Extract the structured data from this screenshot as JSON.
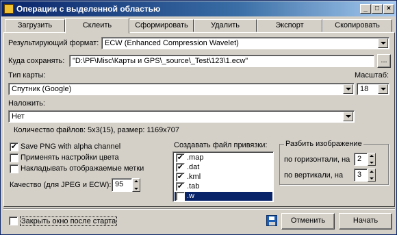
{
  "window": {
    "title": "Операции с выделенной областью"
  },
  "titlebar_buttons": {
    "minimize": "_",
    "maximize": "□",
    "close": "×"
  },
  "tabs": [
    "Загрузить",
    "Склеить",
    "Сформировать",
    "Удалить",
    "Экспорт",
    "Скопировать"
  ],
  "active_tab": "Склеить",
  "form": {
    "format_label": "Результирующий формат:",
    "format_value": "ECW (Enhanced Compression Wavelet)",
    "save_label": "Куда сохранять:",
    "save_value": "\"D:\\PF\\Misc\\Карты и GPS\\_source\\_Test\\123\\1.ecw\"",
    "browse_label": "...",
    "map_type_label": "Тип карты:",
    "map_type_value": "Спутник (Google)",
    "scale_label": "Масштаб:",
    "scale_value": "18",
    "overlay_label": "Наложить:",
    "overlay_value": "Нет",
    "file_info": "Количество файлов: 5x3(15), размер: 1169x707"
  },
  "options": {
    "save_png_alpha": {
      "label": "Save PNG with alpha channel",
      "checked": true
    },
    "apply_color": {
      "label": "Применять настройки цвета",
      "checked": false
    },
    "overlay_marks": {
      "label": "Накладывать отображаемые метки",
      "checked": false
    },
    "quality_label": "Качество (для JPEG и ECW):",
    "quality_value": "95"
  },
  "georef": {
    "title": "Создавать файл привязки:",
    "items": [
      {
        "label": ".map",
        "checked": true,
        "selected": false
      },
      {
        "label": ".dat",
        "checked": true,
        "selected": false
      },
      {
        "label": ".kml",
        "checked": true,
        "selected": false
      },
      {
        "label": ".tab",
        "checked": true,
        "selected": false
      },
      {
        "label": ".w",
        "checked": true,
        "selected": true
      }
    ]
  },
  "split": {
    "title": "Разбить изображение",
    "horizontal_label": "по горизонтали, на",
    "horizontal_value": "2",
    "vertical_label": "по вертикали, на",
    "vertical_value": "3"
  },
  "footer": {
    "close_after_start": {
      "label": "Закрыть окно после старта",
      "checked": false
    },
    "cancel_label": "Отменить",
    "start_label": "Начать"
  },
  "colors": {
    "title_active": "#0a246a",
    "face": "#d4d0c8",
    "selection": "#0a246a"
  },
  "icons": {
    "app": "map-icon",
    "save": "floppy-disk-icon"
  }
}
